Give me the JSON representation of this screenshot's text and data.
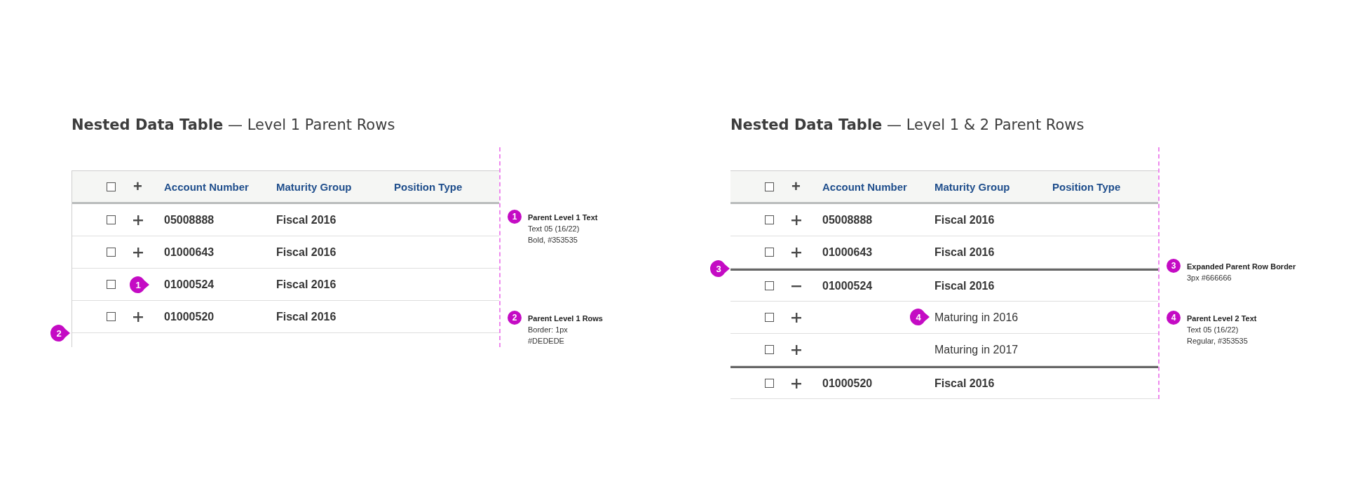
{
  "panels": [
    {
      "title_bold": "Nested Data Table",
      "title_rest": "— Level 1 Parent Rows",
      "left_border": true,
      "header": {
        "checked": false,
        "expander": "+",
        "columns": [
          "Account Number",
          "Maturity Group",
          "Position Type"
        ]
      },
      "rows": [
        {
          "kind": "level1",
          "checked": false,
          "expanded": false,
          "account": "05008888",
          "maturity": "Fiscal 2016"
        },
        {
          "kind": "level1",
          "checked": false,
          "expanded": false,
          "account": "01000643",
          "maturity": "Fiscal 2016"
        },
        {
          "kind": "level1",
          "checked": false,
          "expanded": false,
          "account": "01000524",
          "maturity": "Fiscal 2016",
          "marker": {
            "text": "1",
            "kind": "expander"
          }
        },
        {
          "kind": "level1",
          "checked": false,
          "expanded": false,
          "account": "01000520",
          "maturity": "Fiscal 2016",
          "marker": {
            "text": "2",
            "kind": "edge_bottom"
          }
        }
      ],
      "annotations": [
        {
          "number": "1",
          "title": "Parent Level 1 Text",
          "lines": [
            "Text 05 (16/22)",
            "Bold, #353535"
          ]
        },
        {
          "number": "2",
          "title": "Parent Level 1 Rows",
          "lines": [
            "Border: 1px",
            "#DEDEDE"
          ]
        }
      ]
    },
    {
      "title_bold": "Nested Data Table",
      "title_rest": "— Level 1 & 2 Parent Rows",
      "left_border": false,
      "header": {
        "checked": false,
        "expander": "+",
        "columns": [
          "Account Number",
          "Maturity Group",
          "Position Type"
        ]
      },
      "rows": [
        {
          "kind": "level1",
          "checked": false,
          "expanded": false,
          "account": "05008888",
          "maturity": "Fiscal 2016"
        },
        {
          "kind": "level1",
          "checked": false,
          "expanded": false,
          "account": "01000643",
          "maturity": "Fiscal 2016"
        },
        {
          "kind": "level1",
          "checked": false,
          "expanded": true,
          "account": "01000524",
          "maturity": "Fiscal 2016",
          "marker": {
            "text": "3",
            "kind": "edge_top"
          }
        },
        {
          "kind": "level2",
          "checked": false,
          "expanded": false,
          "maturity": "Maturing in 2016",
          "marker": {
            "text": "4",
            "kind": "maturity"
          }
        },
        {
          "kind": "level2",
          "checked": false,
          "expanded": false,
          "maturity": "Maturing in 2017"
        },
        {
          "kind": "level1",
          "checked": false,
          "expanded": false,
          "account": "01000520",
          "maturity": "Fiscal 2016"
        }
      ],
      "annotations": [
        {
          "number": "3",
          "title": "Expanded Parent Row Border",
          "lines": [
            "3px #666666"
          ]
        },
        {
          "number": "4",
          "title": "Parent Level 2 Text",
          "lines": [
            "Text 05 (16/22)",
            "Regular, #353535"
          ]
        }
      ]
    }
  ]
}
